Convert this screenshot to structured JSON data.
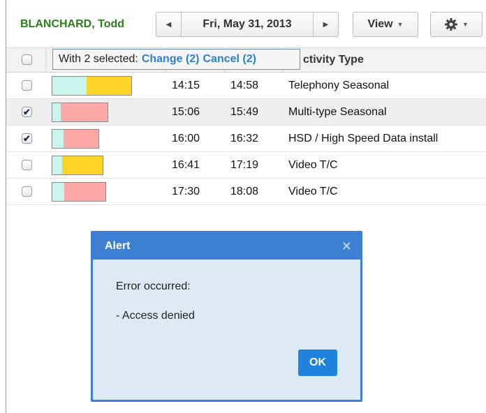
{
  "toolbar": {
    "tech_name": "BLANCHARD, Todd",
    "date_label": "Fri, May 31, 2013",
    "prev_icon": "triangle-left-icon",
    "next_icon": "triangle-right-icon",
    "view_label": "View",
    "settings_icon": "gear-icon"
  },
  "selection_popup": {
    "prefix": "With 2 selected:",
    "change_label": "Change (2)",
    "cancel_label": "Cancel (2)"
  },
  "table": {
    "header_visible_type": "ctivity Type",
    "rows": [
      {
        "checked": false,
        "start": "14:15",
        "end": "14:58",
        "type": "Telephony Seasonal",
        "status_color": "#ffd429"
      },
      {
        "checked": true,
        "start": "15:06",
        "end": "15:49",
        "type": "Multi-type Seasonal",
        "status_color": "#ffa8a8"
      },
      {
        "checked": true,
        "start": "16:00",
        "end": "16:32",
        "type": "HSD / High Speed Data install",
        "status_color": "#ffa8a8"
      },
      {
        "checked": false,
        "start": "16:41",
        "end": "17:19",
        "type": "Video T/C",
        "status_color": "#ffd429"
      },
      {
        "checked": false,
        "start": "17:30",
        "end": "18:08",
        "type": "Video T/C",
        "status_color": "#ffa8a8"
      }
    ]
  },
  "alert": {
    "title": "Alert",
    "line1": "Error occurred:",
    "line2": "- Access denied",
    "ok_label": "OK",
    "close_icon": "close-icon"
  },
  "colors": {
    "tech_name": "#2a7f1a",
    "link": "#2f7fce",
    "dialog_header": "#3d7fd2",
    "dialog_body": "#ddeaf6",
    "ok_button": "#1f82dc",
    "progress_fill": "#c9f5ee"
  }
}
